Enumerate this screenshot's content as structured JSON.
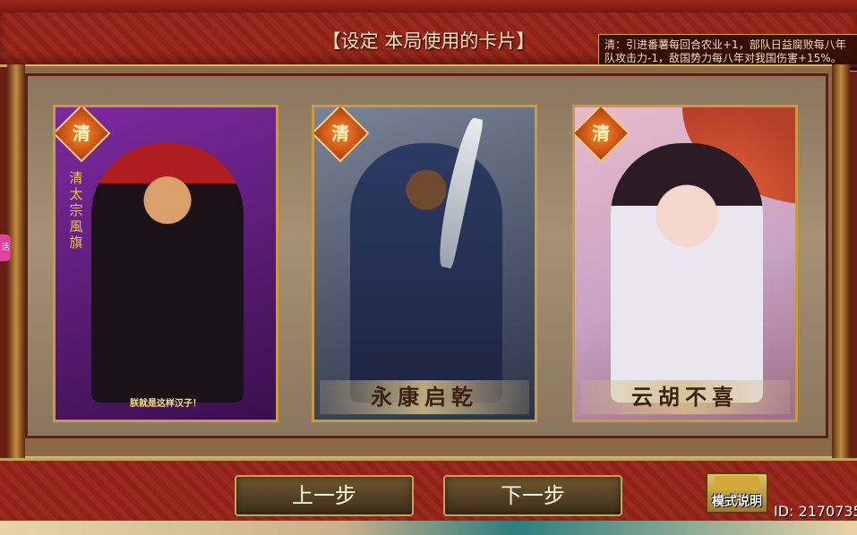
{
  "header": {
    "title": "【设定 本局使用的卡片】",
    "faction_tip_line1": "清：引进番薯每回合农业+1，部队日益腐败每八年",
    "faction_tip_line2": "队攻击力-1，敌国势力每八年对我国伤害+15%。"
  },
  "cards": [
    {
      "faction": "清",
      "label": "",
      "vertical_name": "清太宗 風旗",
      "quote": "朕就是这样汉子！"
    },
    {
      "faction": "清",
      "label": "永康启乾",
      "vertical_name": "",
      "quote": ""
    },
    {
      "faction": "清",
      "label": "云胡不喜",
      "vertical_name": "",
      "quote": ""
    }
  ],
  "buttons": {
    "prev": "上一步",
    "next": "下一步",
    "mode": "模式说明"
  },
  "footer": {
    "user_id": "ID: 2170735"
  },
  "side_badge": "活"
}
